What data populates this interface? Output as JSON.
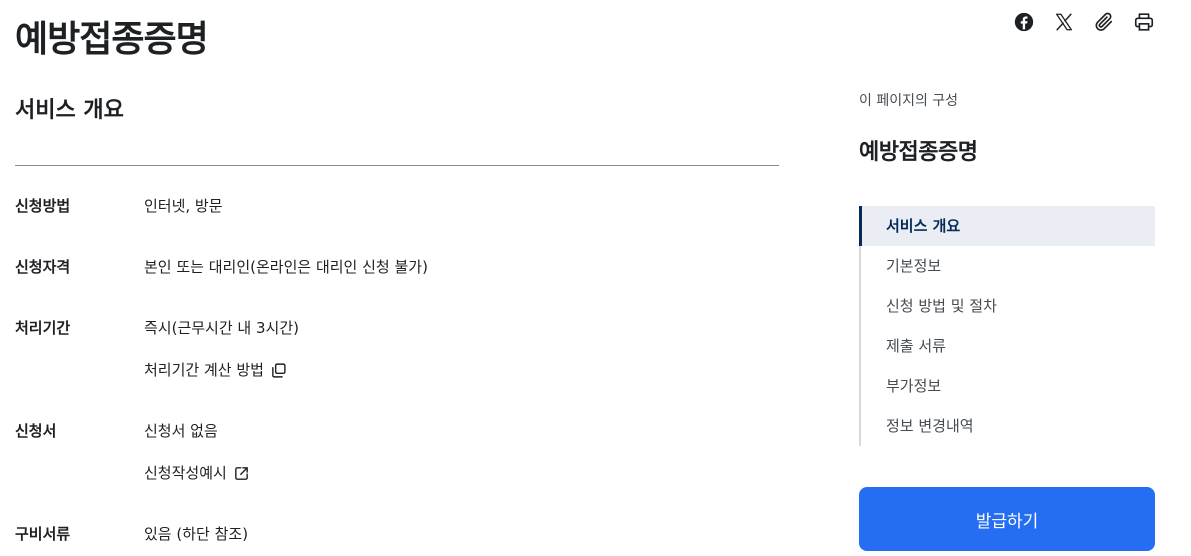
{
  "page": {
    "title": "예방접종증명"
  },
  "share_tools": [
    {
      "name": "facebook-icon"
    },
    {
      "name": "x-icon"
    },
    {
      "name": "paperclip-icon"
    },
    {
      "name": "print-icon"
    }
  ],
  "overview": {
    "title": "서비스 개요",
    "rows": [
      {
        "label": "신청방법",
        "values": [
          {
            "text": "인터넷, 방문"
          }
        ]
      },
      {
        "label": "신청자격",
        "values": [
          {
            "text": "본인 또는 대리인(온라인은 대리인 신청 불가)"
          }
        ]
      },
      {
        "label": "처리기간",
        "values": [
          {
            "text": "즉시(근무시간 내 3시간)"
          },
          {
            "text": "처리기간 계산 방법",
            "icon": "copy-icon"
          }
        ]
      },
      {
        "label": "신청서",
        "values": [
          {
            "text": "신청서 없음"
          },
          {
            "text": "신청작성예시",
            "icon": "external-link-icon"
          }
        ]
      },
      {
        "label": "구비서류",
        "values": [
          {
            "text": "있음 (하단 참조)"
          }
        ]
      }
    ]
  },
  "toc": {
    "caption": "이 페이지의 구성",
    "title": "예방접종증명",
    "items": [
      {
        "label": "서비스 개요",
        "active": true
      },
      {
        "label": "기본정보"
      },
      {
        "label": "신청 방법 및 절차"
      },
      {
        "label": "제출 서류"
      },
      {
        "label": "부가정보"
      },
      {
        "label": "정보 변경내역"
      }
    ]
  },
  "issue_button": {
    "label": "발급하기"
  },
  "colors": {
    "accent": "#256ef4",
    "toc_active": "#052b57",
    "toc_active_bg": "#eaeef4"
  }
}
